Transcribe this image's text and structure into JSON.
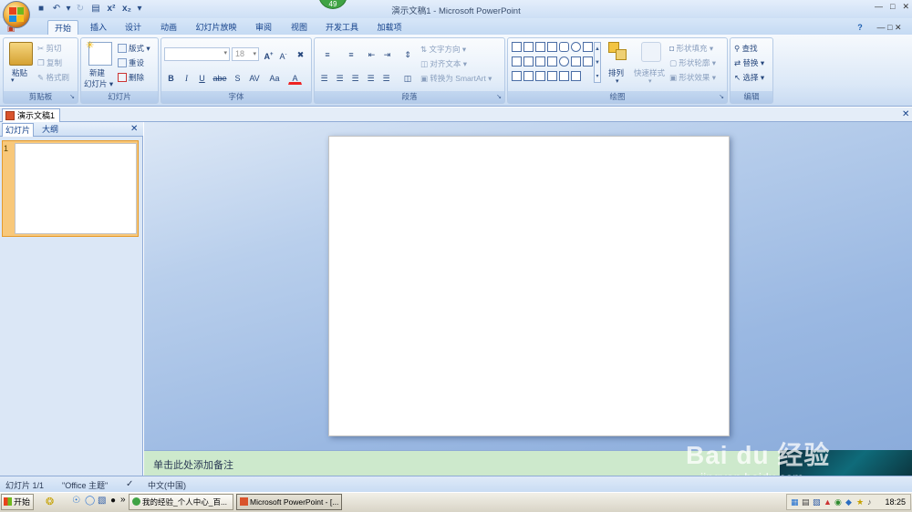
{
  "app": {
    "title": "演示文稿1 - Microsoft PowerPoint",
    "update_badge": "49",
    "window_controls": [
      "—",
      "□",
      "✕"
    ],
    "qat_icons": [
      "save-icon",
      "undo-icon",
      "redo-icon",
      "print-preview-icon",
      "superscript-icon",
      "subscript-icon",
      "customize-icon"
    ]
  },
  "ribbon": {
    "tabs": [
      "开始",
      "插入",
      "设计",
      "动画",
      "幻灯片放映",
      "审阅",
      "视图",
      "开发工具",
      "加载项"
    ],
    "active_tab": "开始",
    "clipboard": {
      "label": "剪贴板",
      "paste": "粘贴",
      "cut": "剪切",
      "copy": "复制",
      "format_painter": "格式刷"
    },
    "slides": {
      "label": "幻灯片",
      "new_slide_1": "新建",
      "new_slide_2": "幻灯片",
      "layout": "版式",
      "reset": "重设",
      "delete": "删除"
    },
    "font": {
      "label": "字体",
      "font_name": "",
      "font_size": "18",
      "grow": "A",
      "shrink": "A",
      "bold": "B",
      "italic": "I",
      "underline": "U",
      "strike": "abe",
      "shadow": "S",
      "spacing": "AV",
      "case": "Aa",
      "color": "A"
    },
    "paragraph": {
      "label": "段落",
      "text_direction": "文字方向",
      "align_text": "对齐文本",
      "smartart": "转换为 SmartArt"
    },
    "drawing": {
      "label": "绘图",
      "arrange": "排列",
      "quick_styles": "快速样式",
      "shape_fill": "形状填充",
      "shape_outline": "形状轮廓",
      "shape_effects": "形状效果"
    },
    "editing": {
      "label": "编辑",
      "find": "查找",
      "replace": "替换",
      "select": "选择"
    }
  },
  "document": {
    "tab_title": "演示文稿1"
  },
  "left_panel": {
    "tabs": [
      "幻灯片",
      "大纲"
    ],
    "slide_number": "1"
  },
  "notes": {
    "placeholder": "单击此处添加备注"
  },
  "status": {
    "slide": "幻灯片 1/1",
    "theme": "\"Office 主题\"",
    "language": "中文(中国)"
  },
  "taskbar": {
    "start": "开始",
    "tasks": [
      "我的经验_个人中心_百...",
      "Microsoft PowerPoint - [..."
    ],
    "clock": "18:25",
    "more": "»"
  },
  "watermark": {
    "brand": "Bai du 经验",
    "url": "jingyan.baidu.com"
  },
  "colors": {
    "accent": "#15428b",
    "active_tab": "#f4f8fd",
    "notes_bg": "#cde9cc",
    "thumb_select": "#f8c87a"
  }
}
